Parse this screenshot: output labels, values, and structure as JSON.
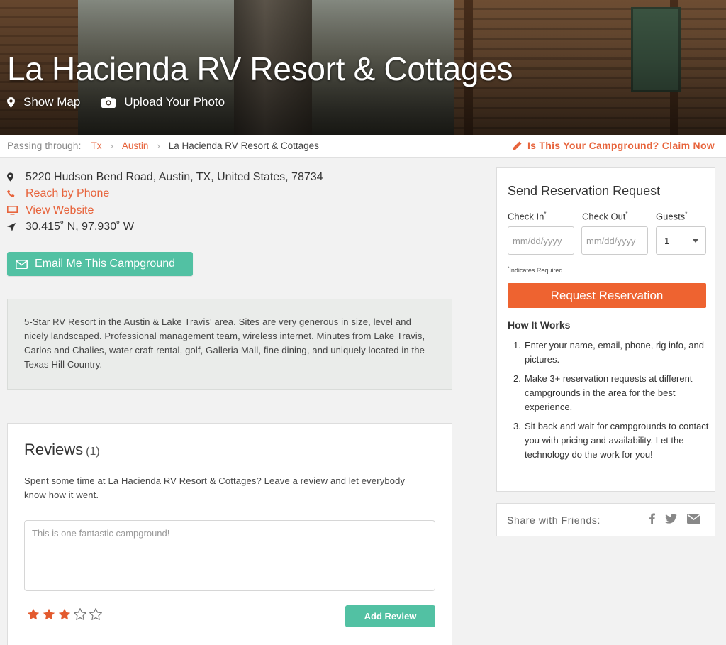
{
  "hero": {
    "title": "La Hacienda RV Resort & Cottages",
    "show_map": "Show Map",
    "upload_photo": "Upload Your Photo"
  },
  "breadcrumb": {
    "label": "Passing through:",
    "items": [
      "Tx",
      "Austin"
    ],
    "current": "La Hacienda RV Resort & Cottages",
    "claim": "Is This Your Campground? Claim Now"
  },
  "details": {
    "address": "5220 Hudson Bend Road, Austin, TX, United States, 78734",
    "phone": "Reach by Phone",
    "website": "View Website",
    "coords": "30.415˚ N, 97.930˚ W"
  },
  "email_button": "Email Me This Campground",
  "description": "5-Star RV Resort in the Austin & Lake Travis' area. Sites are very generous in size, level and nicely landscaped. Professional management team, wireless internet. Minutes from Lake Travis, Carlos and Chalies, water craft rental, golf, Galleria Mall, fine dining, and uniquely located in the Texas Hill Country.",
  "reviews": {
    "title": "Reviews",
    "count": "(1)",
    "prompt": "Spent some time at La Hacienda RV Resort & Cottages? Leave a review and let everybody know how it went.",
    "placeholder": "This is one fantastic campground!",
    "rating": 3,
    "max_rating": 5,
    "add_button": "Add Review"
  },
  "reservation": {
    "title": "Send Reservation Request",
    "check_in_label": "Check In",
    "check_out_label": "Check Out",
    "guests_label": "Guests",
    "required_mark": "*",
    "date_placeholder": "mm/dd/yyyy",
    "guests_value": "1",
    "required_note": "Indicates Required",
    "button": "Request Reservation",
    "how_title": "How It Works",
    "steps": [
      {
        "n": "1.",
        "text": "Enter your name, email, phone, rig info, and pictures."
      },
      {
        "n": "2.",
        "text": "Make 3+ reservation requests at different campgrounds in the area for the best experience."
      },
      {
        "n": "3.",
        "text": "Sit back and wait for campgrounds to contact you with pricing and availability. Let the technology do the work for you!"
      }
    ]
  },
  "share": {
    "label": "Share with Friends:"
  },
  "colors": {
    "accent": "#e7643c",
    "teal": "#52c1a3",
    "reserve": "#ee6330",
    "star": "#e35a2e"
  },
  "icons": [
    "map-marker-icon",
    "camera-icon",
    "pencil-icon",
    "phone-icon",
    "monitor-icon",
    "location-arrow-icon",
    "envelope-icon",
    "facebook-icon",
    "twitter-icon",
    "star-icon"
  ]
}
